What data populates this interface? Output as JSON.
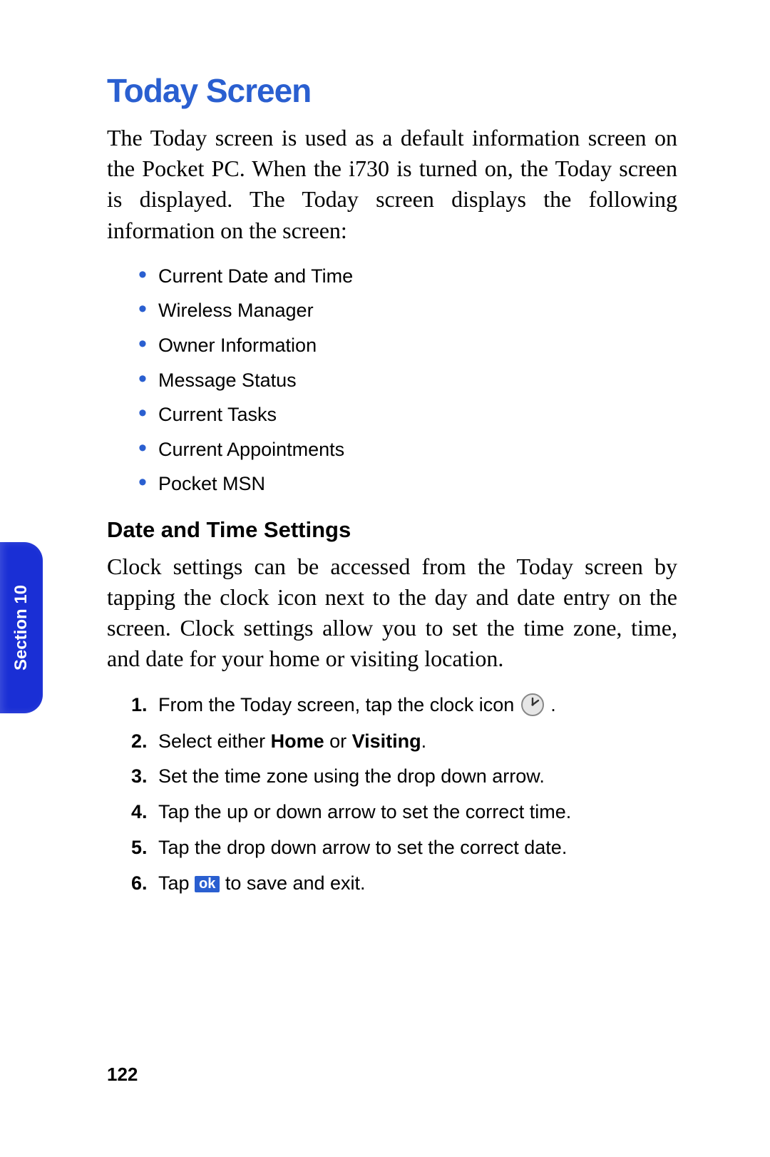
{
  "title": "Today Screen",
  "intro": "The Today screen is used as a default information screen on the Pocket PC. When the i730 is turned on, the Today screen is displayed. The Today screen displays the following information on the screen:",
  "bullets": [
    "Current Date and Time",
    "Wireless Manager",
    "Owner Information",
    "Message Status",
    "Current Tasks",
    "Current Appointments",
    "Pocket MSN"
  ],
  "subhead": "Date and Time Settings",
  "para2": "Clock settings can be accessed from the Today screen by tapping the clock icon next to the day and date entry on the screen. Clock settings allow you to set the time zone, time, and date for your home or visiting location.",
  "steps": {
    "s1_pre": "From the Today screen, tap the clock icon ",
    "s1_post": ".",
    "s2_pre": "Select either ",
    "s2_b1": "Home",
    "s2_mid": " or ",
    "s2_b2": "Visiting",
    "s2_post": ".",
    "s3": "Set the time zone using the drop down arrow.",
    "s4": "Tap the up or down arrow to set the correct time.",
    "s5": "Tap the drop down arrow to set the correct date.",
    "s6_pre": "Tap ",
    "s6_badge": "ok",
    "s6_post": " to save and exit."
  },
  "sideTab": "Section 10",
  "pageNumber": "122"
}
